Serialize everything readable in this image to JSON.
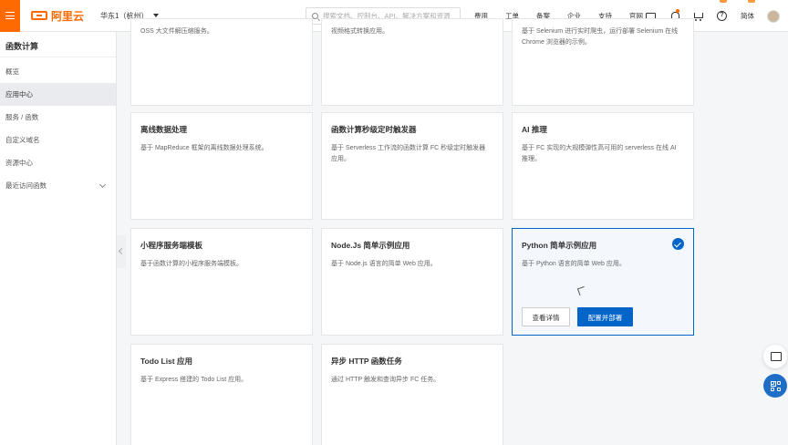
{
  "header": {
    "logo_text": "阿里云",
    "region": "华东1（杭州）",
    "search_placeholder": "搜索文档、控制台、API、解决方案和资源",
    "nav": [
      "费用",
      "工单",
      "备案",
      "企业",
      "支持",
      "官网"
    ],
    "lang": "简体",
    "icons": [
      "screen-icon",
      "bell-icon",
      "cart-icon",
      "help-icon"
    ],
    "accent_color": "#ff6a00"
  },
  "sidebar": {
    "title": "函数计算",
    "items": [
      {
        "label": "概览",
        "active": false
      },
      {
        "label": "应用中心",
        "active": true
      },
      {
        "label": "服务 / 函数",
        "active": false
      },
      {
        "label": "自定义域名",
        "active": false
      },
      {
        "label": "资源中心",
        "active": false
      },
      {
        "label": "最近访问函数",
        "active": false,
        "expandable": true
      }
    ]
  },
  "cards": {
    "top_row": [
      {
        "desc": "OSS 大文件解压缩服务。"
      },
      {
        "desc": "视频格式转换应用。"
      },
      {
        "desc": "基于 Selenium 进行实时爬虫，运行部署 Selenium 在线 Chrome 浏览器的示例。"
      }
    ],
    "c1": {
      "title": "离线数据处理",
      "desc": "基于 MapReduce 框架的离线数据处理系统。"
    },
    "c2": {
      "title": "函数计算秒级定时触发器",
      "desc": "基于 Serverless 工作流的函数计算 FC 秒级定时触发器应用。"
    },
    "c3": {
      "title": "AI 推理",
      "desc": "基于 FC 实现的大规模弹性高可用的 serverless 在线 AI 推理。"
    },
    "c4": {
      "title": "小程序服务端模板",
      "desc": "基于函数计算的小程序服务端模板。"
    },
    "c5": {
      "title": "Node.Js 简单示例应用",
      "desc": "基于 Node.js 语言的简单 Web 应用。"
    },
    "c6": {
      "title": "Python 简单示例应用",
      "desc": "基于 Python 语言的简单 Web 应用。",
      "selected": true,
      "view_label": "查看详情",
      "deploy_label": "配置并部署"
    },
    "c7": {
      "title": "Todo List 应用",
      "desc": "基于 Express 搭建的 Todo List 应用。"
    },
    "c8": {
      "title": "异步 HTTP 函数任务",
      "desc": "通过 HTTP 触发和查询异步 FC 任务。"
    }
  },
  "primary_color": "#0064c8"
}
